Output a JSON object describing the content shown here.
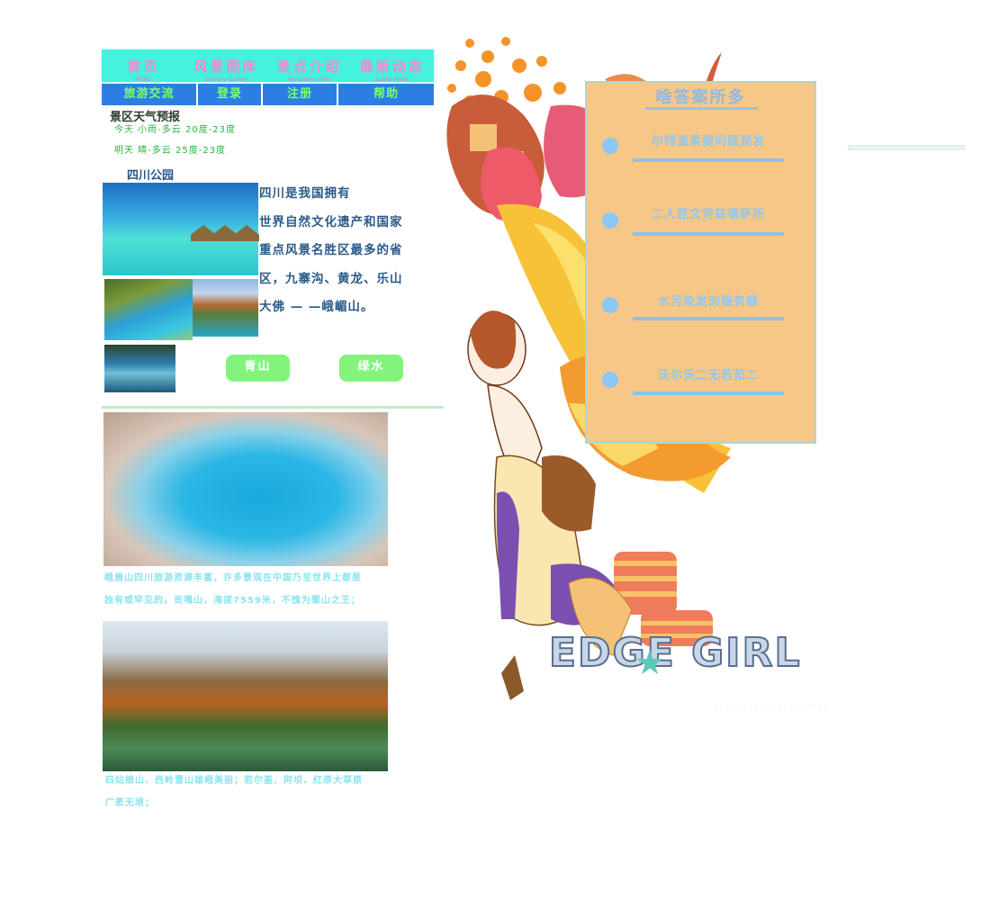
{
  "nav": {
    "items": [
      {
        "cn": "首页",
        "en": "HOME"
      },
      {
        "cn": "风景图库",
        "en": "Scenery Gallery"
      },
      {
        "cn": "景点介绍",
        "en": "Attractions Intro"
      },
      {
        "cn": "最新动态",
        "en": "Latest News"
      }
    ],
    "sub": [
      "旅游交流",
      "登录",
      "注册",
      "帮助"
    ]
  },
  "weather": {
    "title": "景区天气预报",
    "today": "今天  小雨-多云    20度-23度",
    "tomorrow": "明天  晴-多云    25度-23度"
  },
  "park": {
    "title": "四川公园",
    "intro_lines": [
      "四川是我国拥有",
      "世界自然文化遗产和国家",
      "重点风景名胜区最多的省",
      "区，九寨沟、黄龙、乐山",
      "大佛 — —峨嵋山。"
    ],
    "buttons": [
      "青山",
      "绿水"
    ]
  },
  "articles": [
    {
      "lines": [
        "峨眉山四川旅游资源丰富，许多景观在中国乃至世界上都是",
        "独有或罕见的。贡嘎山，海拔7559米，不愧为蜀山之王；"
      ]
    },
    {
      "lines": [
        "四姑娘山、西岭雪山雄峨美丽；若尔盖、阿坝、红原大草原",
        "广袤无垠；"
      ]
    }
  ],
  "panel": {
    "title": "啥答案所多",
    "items": [
      "尔特温柔提问题润发",
      "二人茬文劳兹德萨所",
      "水污染发的服务器",
      "沃尔沃二无若茹二"
    ]
  },
  "illustration": {
    "logo_text": "EDGE GIRL"
  },
  "colors": {
    "nav_bg": "#44f2dd",
    "subnav_bg": "#2b7fe3",
    "panel_bg": "#f6c786",
    "green_button": "#82f47c"
  }
}
